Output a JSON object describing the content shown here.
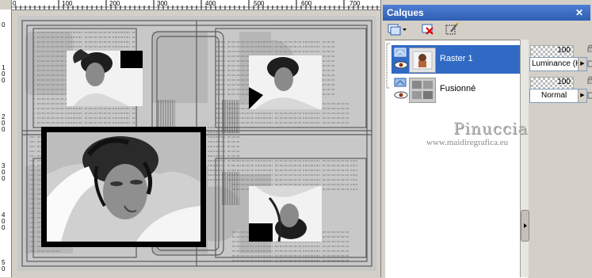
{
  "rulers": {
    "top": [
      "0",
      "100",
      "200",
      "300",
      "400",
      "500",
      "600",
      "700"
    ],
    "left": [
      "0",
      "1 0 0",
      "2 0 0",
      "3 0 0",
      "4 0 0",
      "5 0"
    ]
  },
  "panel": {
    "title": "Calques",
    "toolbar": {
      "new_layer_icon": "new-raster-layer-icon",
      "delete_icon": "delete-layer-icon",
      "edit_icon": "edit-selection-icon"
    },
    "layers": [
      {
        "name": "Raster 1",
        "selected": true,
        "opacity": "100",
        "blend_mode": "Luminance (H)"
      },
      {
        "name": "Fusionné",
        "selected": false,
        "opacity": "100",
        "blend_mode": "Normal"
      }
    ]
  },
  "watermark": {
    "name": "Pinuccia",
    "url": "www.maidiregrafica.eu"
  },
  "colors": {
    "title_bar": "#2f5fb3",
    "selection": "#316ac5",
    "panel_bg": "#d4d0c8"
  }
}
